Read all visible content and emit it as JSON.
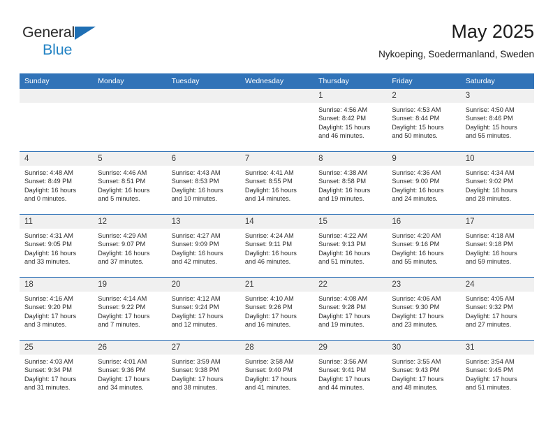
{
  "brand": {
    "name_line1": "General",
    "name_line2": "Blue",
    "triangle_icon": "triangle-icon",
    "color_dark": "#2b2b2b",
    "color_blue": "#2383c4"
  },
  "header": {
    "title": "May 2025",
    "subtitle": "Nykoeping, Soedermanland, Sweden"
  },
  "theme": {
    "header_blue": "#3173b8",
    "daynum_gray": "#f0f0f0",
    "text": "#2c2c2c"
  },
  "calendar": {
    "weekday_headers": [
      "Sunday",
      "Monday",
      "Tuesday",
      "Wednesday",
      "Thursday",
      "Friday",
      "Saturday"
    ],
    "weeks": [
      [
        {
          "day": "",
          "empty": true
        },
        {
          "day": "",
          "empty": true
        },
        {
          "day": "",
          "empty": true
        },
        {
          "day": "",
          "empty": true
        },
        {
          "day": "1",
          "sunrise": "Sunrise: 4:56 AM",
          "sunset": "Sunset: 8:42 PM",
          "daylight_line1": "Daylight: 15 hours",
          "daylight_line2": "and 46 minutes."
        },
        {
          "day": "2",
          "sunrise": "Sunrise: 4:53 AM",
          "sunset": "Sunset: 8:44 PM",
          "daylight_line1": "Daylight: 15 hours",
          "daylight_line2": "and 50 minutes."
        },
        {
          "day": "3",
          "sunrise": "Sunrise: 4:50 AM",
          "sunset": "Sunset: 8:46 PM",
          "daylight_line1": "Daylight: 15 hours",
          "daylight_line2": "and 55 minutes."
        }
      ],
      [
        {
          "day": "4",
          "sunrise": "Sunrise: 4:48 AM",
          "sunset": "Sunset: 8:49 PM",
          "daylight_line1": "Daylight: 16 hours",
          "daylight_line2": "and 0 minutes."
        },
        {
          "day": "5",
          "sunrise": "Sunrise: 4:46 AM",
          "sunset": "Sunset: 8:51 PM",
          "daylight_line1": "Daylight: 16 hours",
          "daylight_line2": "and 5 minutes."
        },
        {
          "day": "6",
          "sunrise": "Sunrise: 4:43 AM",
          "sunset": "Sunset: 8:53 PM",
          "daylight_line1": "Daylight: 16 hours",
          "daylight_line2": "and 10 minutes."
        },
        {
          "day": "7",
          "sunrise": "Sunrise: 4:41 AM",
          "sunset": "Sunset: 8:55 PM",
          "daylight_line1": "Daylight: 16 hours",
          "daylight_line2": "and 14 minutes."
        },
        {
          "day": "8",
          "sunrise": "Sunrise: 4:38 AM",
          "sunset": "Sunset: 8:58 PM",
          "daylight_line1": "Daylight: 16 hours",
          "daylight_line2": "and 19 minutes."
        },
        {
          "day": "9",
          "sunrise": "Sunrise: 4:36 AM",
          "sunset": "Sunset: 9:00 PM",
          "daylight_line1": "Daylight: 16 hours",
          "daylight_line2": "and 24 minutes."
        },
        {
          "day": "10",
          "sunrise": "Sunrise: 4:34 AM",
          "sunset": "Sunset: 9:02 PM",
          "daylight_line1": "Daylight: 16 hours",
          "daylight_line2": "and 28 minutes."
        }
      ],
      [
        {
          "day": "11",
          "sunrise": "Sunrise: 4:31 AM",
          "sunset": "Sunset: 9:05 PM",
          "daylight_line1": "Daylight: 16 hours",
          "daylight_line2": "and 33 minutes."
        },
        {
          "day": "12",
          "sunrise": "Sunrise: 4:29 AM",
          "sunset": "Sunset: 9:07 PM",
          "daylight_line1": "Daylight: 16 hours",
          "daylight_line2": "and 37 minutes."
        },
        {
          "day": "13",
          "sunrise": "Sunrise: 4:27 AM",
          "sunset": "Sunset: 9:09 PM",
          "daylight_line1": "Daylight: 16 hours",
          "daylight_line2": "and 42 minutes."
        },
        {
          "day": "14",
          "sunrise": "Sunrise: 4:24 AM",
          "sunset": "Sunset: 9:11 PM",
          "daylight_line1": "Daylight: 16 hours",
          "daylight_line2": "and 46 minutes."
        },
        {
          "day": "15",
          "sunrise": "Sunrise: 4:22 AM",
          "sunset": "Sunset: 9:13 PM",
          "daylight_line1": "Daylight: 16 hours",
          "daylight_line2": "and 51 minutes."
        },
        {
          "day": "16",
          "sunrise": "Sunrise: 4:20 AM",
          "sunset": "Sunset: 9:16 PM",
          "daylight_line1": "Daylight: 16 hours",
          "daylight_line2": "and 55 minutes."
        },
        {
          "day": "17",
          "sunrise": "Sunrise: 4:18 AM",
          "sunset": "Sunset: 9:18 PM",
          "daylight_line1": "Daylight: 16 hours",
          "daylight_line2": "and 59 minutes."
        }
      ],
      [
        {
          "day": "18",
          "sunrise": "Sunrise: 4:16 AM",
          "sunset": "Sunset: 9:20 PM",
          "daylight_line1": "Daylight: 17 hours",
          "daylight_line2": "and 3 minutes."
        },
        {
          "day": "19",
          "sunrise": "Sunrise: 4:14 AM",
          "sunset": "Sunset: 9:22 PM",
          "daylight_line1": "Daylight: 17 hours",
          "daylight_line2": "and 7 minutes."
        },
        {
          "day": "20",
          "sunrise": "Sunrise: 4:12 AM",
          "sunset": "Sunset: 9:24 PM",
          "daylight_line1": "Daylight: 17 hours",
          "daylight_line2": "and 12 minutes."
        },
        {
          "day": "21",
          "sunrise": "Sunrise: 4:10 AM",
          "sunset": "Sunset: 9:26 PM",
          "daylight_line1": "Daylight: 17 hours",
          "daylight_line2": "and 16 minutes."
        },
        {
          "day": "22",
          "sunrise": "Sunrise: 4:08 AM",
          "sunset": "Sunset: 9:28 PM",
          "daylight_line1": "Daylight: 17 hours",
          "daylight_line2": "and 19 minutes."
        },
        {
          "day": "23",
          "sunrise": "Sunrise: 4:06 AM",
          "sunset": "Sunset: 9:30 PM",
          "daylight_line1": "Daylight: 17 hours",
          "daylight_line2": "and 23 minutes."
        },
        {
          "day": "24",
          "sunrise": "Sunrise: 4:05 AM",
          "sunset": "Sunset: 9:32 PM",
          "daylight_line1": "Daylight: 17 hours",
          "daylight_line2": "and 27 minutes."
        }
      ],
      [
        {
          "day": "25",
          "sunrise": "Sunrise: 4:03 AM",
          "sunset": "Sunset: 9:34 PM",
          "daylight_line1": "Daylight: 17 hours",
          "daylight_line2": "and 31 minutes."
        },
        {
          "day": "26",
          "sunrise": "Sunrise: 4:01 AM",
          "sunset": "Sunset: 9:36 PM",
          "daylight_line1": "Daylight: 17 hours",
          "daylight_line2": "and 34 minutes."
        },
        {
          "day": "27",
          "sunrise": "Sunrise: 3:59 AM",
          "sunset": "Sunset: 9:38 PM",
          "daylight_line1": "Daylight: 17 hours",
          "daylight_line2": "and 38 minutes."
        },
        {
          "day": "28",
          "sunrise": "Sunrise: 3:58 AM",
          "sunset": "Sunset: 9:40 PM",
          "daylight_line1": "Daylight: 17 hours",
          "daylight_line2": "and 41 minutes."
        },
        {
          "day": "29",
          "sunrise": "Sunrise: 3:56 AM",
          "sunset": "Sunset: 9:41 PM",
          "daylight_line1": "Daylight: 17 hours",
          "daylight_line2": "and 44 minutes."
        },
        {
          "day": "30",
          "sunrise": "Sunrise: 3:55 AM",
          "sunset": "Sunset: 9:43 PM",
          "daylight_line1": "Daylight: 17 hours",
          "daylight_line2": "and 48 minutes."
        },
        {
          "day": "31",
          "sunrise": "Sunrise: 3:54 AM",
          "sunset": "Sunset: 9:45 PM",
          "daylight_line1": "Daylight: 17 hours",
          "daylight_line2": "and 51 minutes."
        }
      ]
    ]
  }
}
